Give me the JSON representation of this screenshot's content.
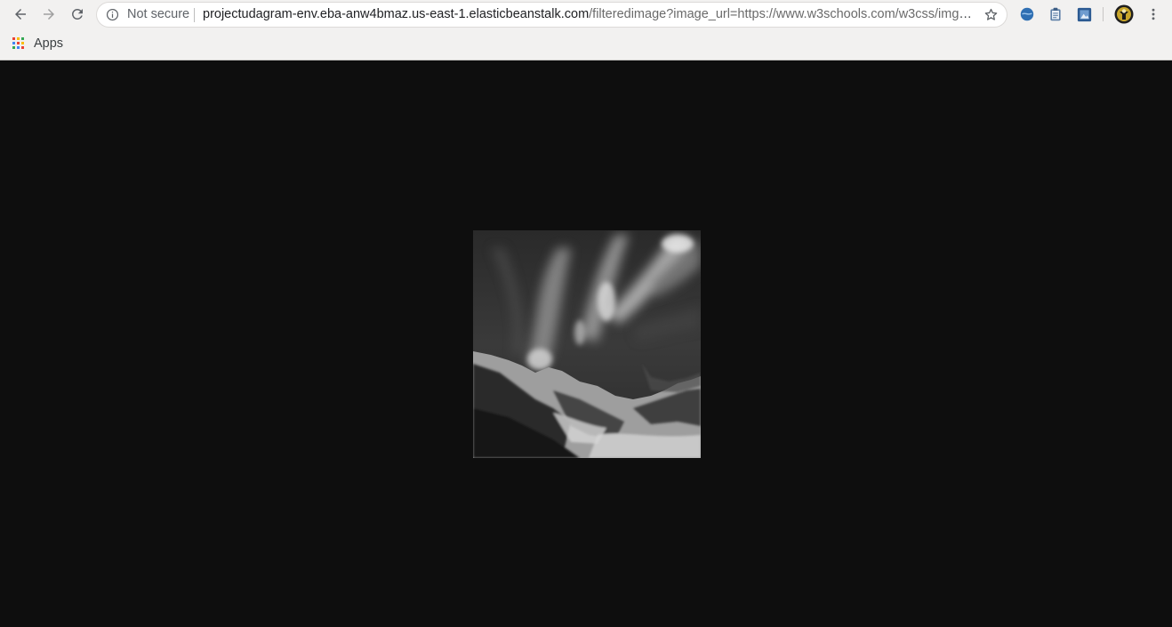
{
  "browser": {
    "security_label": "Not secure",
    "url_host": "projectudagram-env.eba-anw4bmaz.us-east-1.elasticbeanstalk.com",
    "url_rest": "/filteredimage?image_url=https://www.w3schools.com/w3css/img_l...",
    "bookmarks": {
      "apps_label": "Apps"
    }
  },
  "colors": {
    "toolbar_bg": "#f2f1f0",
    "page_bg": "#0e0e0e",
    "apps_grid": [
      "#ea4335",
      "#fbbc05",
      "#34a853",
      "#4285f4",
      "#ea4335",
      "#fbbc05",
      "#34a853",
      "#4285f4",
      "#ea4335"
    ]
  },
  "icons": {
    "back": "arrow-left-icon",
    "forward": "arrow-right-icon",
    "reload": "reload-icon",
    "info": "info-icon",
    "bookmark_star": "star-icon",
    "extensions": [
      "globe-extension-icon",
      "clipboard-extension-icon",
      "photo-extension-icon"
    ],
    "profile": "profile-avatar",
    "menu": "kebab-menu-icon",
    "apps": "apps-grid-icon"
  },
  "page": {
    "image_subject": "grayscale aurora over snowy mountains"
  }
}
